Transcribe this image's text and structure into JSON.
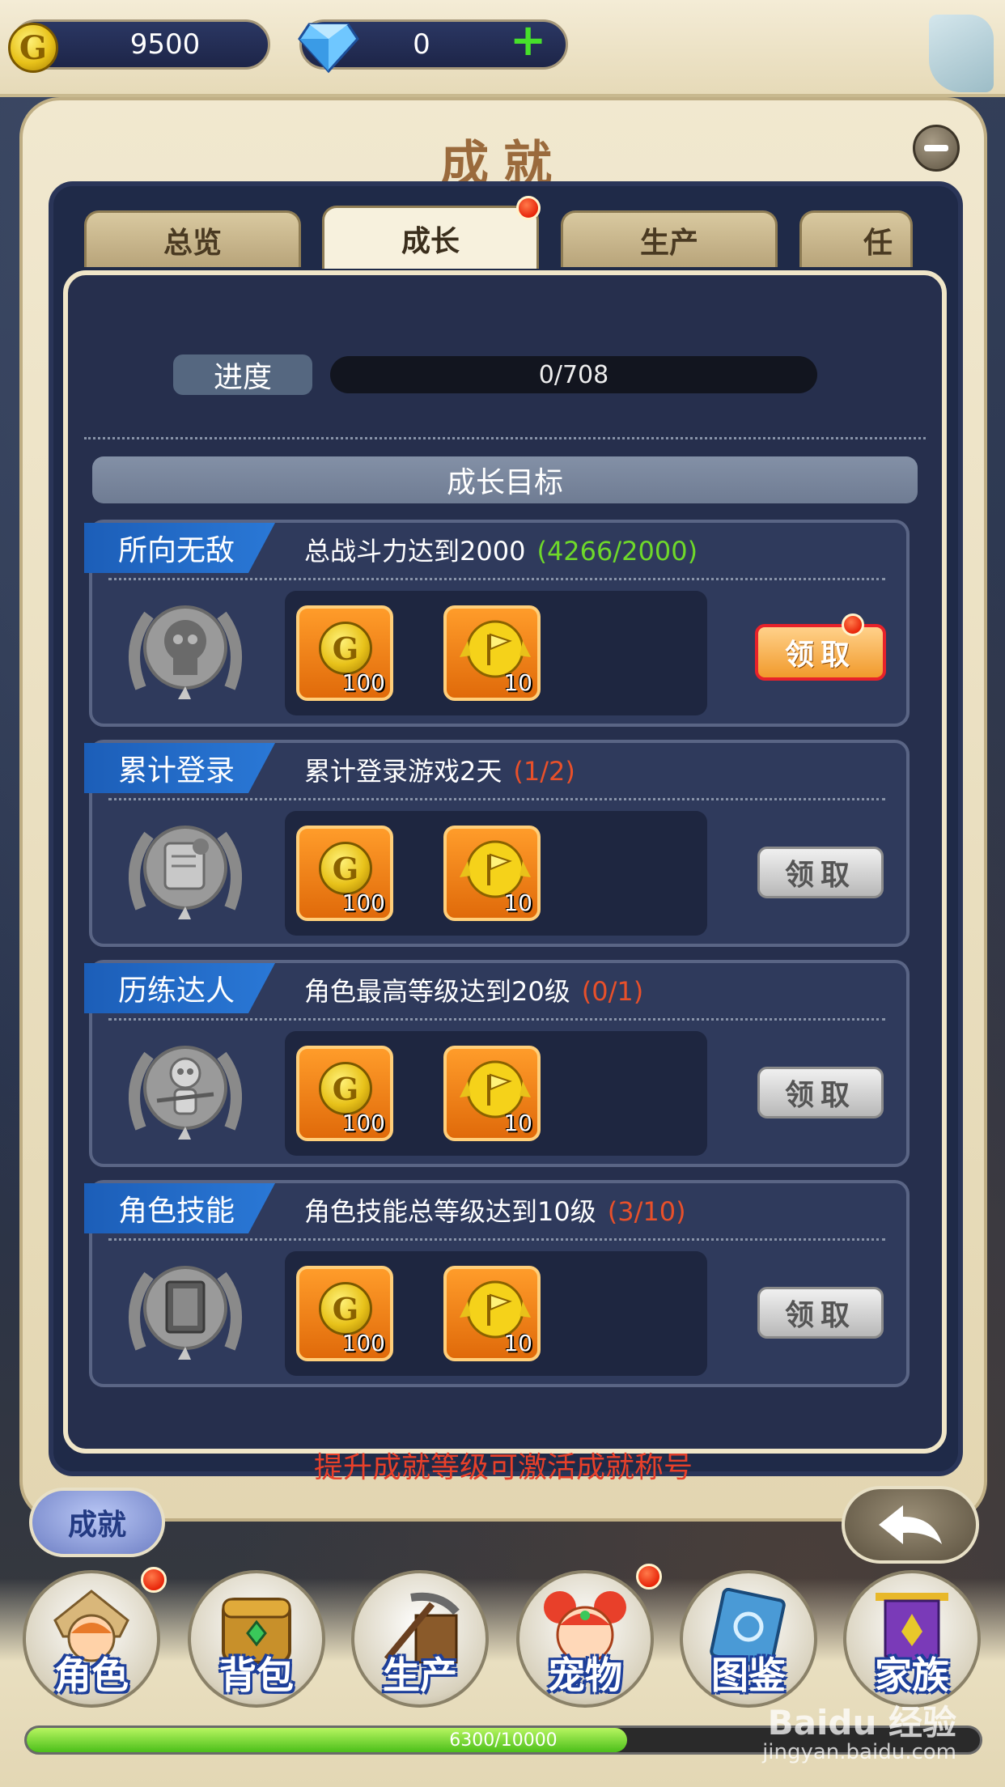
{
  "resources": {
    "gold_symbol": "G",
    "gold": "9500",
    "gems": "0",
    "add_symbol": "+"
  },
  "panel": {
    "title": "成就"
  },
  "tabs": [
    {
      "label": "总览",
      "active": false,
      "badge": false
    },
    {
      "label": "成长",
      "active": true,
      "badge": true
    },
    {
      "label": "生产",
      "active": false,
      "badge": false
    },
    {
      "label": "任",
      "active": false,
      "badge": false
    }
  ],
  "progress": {
    "label": "进度",
    "value": "0/708"
  },
  "section_title": "成长目标",
  "achievements": [
    {
      "name": "所向无敌",
      "desc": "总战斗力达到2000",
      "progress": "(4266/2000)",
      "progress_color": "green",
      "medal_icon": "skull-medal-icon",
      "rewards": [
        {
          "icon": "gold-coin-icon",
          "symbol": "G",
          "count": "100"
        },
        {
          "icon": "flag-coin-icon",
          "count": "10"
        }
      ],
      "claim_label": "领取",
      "claimable": true
    },
    {
      "name": "累计登录",
      "desc": "累计登录游戏2天",
      "progress": "(1/2)",
      "progress_color": "red",
      "medal_icon": "scroll-medal-icon",
      "rewards": [
        {
          "icon": "gold-coin-icon",
          "symbol": "G",
          "count": "100"
        },
        {
          "icon": "flag-coin-icon",
          "count": "10"
        }
      ],
      "claim_label": "领取",
      "claimable": false
    },
    {
      "name": "历练达人",
      "desc": "角色最高等级达到20级",
      "progress": "(0/1)",
      "progress_color": "red",
      "medal_icon": "skeleton-medal-icon",
      "rewards": [
        {
          "icon": "gold-coin-icon",
          "symbol": "G",
          "count": "100"
        },
        {
          "icon": "flag-coin-icon",
          "count": "10"
        }
      ],
      "claim_label": "领取",
      "claimable": false
    },
    {
      "name": "角色技能",
      "desc": "角色技能总等级达到10级",
      "progress": "(3/10)",
      "progress_color": "red",
      "medal_icon": "book-medal-icon",
      "rewards": [
        {
          "icon": "gold-coin-icon",
          "symbol": "G",
          "count": "100"
        },
        {
          "icon": "flag-coin-icon",
          "count": "10"
        }
      ],
      "claim_label": "领取",
      "claimable": false
    }
  ],
  "hint": "提升成就等级可激活成就称号",
  "achievement_button": "成就",
  "nav": [
    {
      "label": "角色",
      "icon": "character-icon",
      "badge": true
    },
    {
      "label": "背包",
      "icon": "backpack-icon",
      "badge": false
    },
    {
      "label": "生产",
      "icon": "pickaxe-icon",
      "badge": false
    },
    {
      "label": "宠物",
      "icon": "pet-icon",
      "badge": true
    },
    {
      "label": "图鉴",
      "icon": "codex-icon",
      "badge": false
    },
    {
      "label": "家族",
      "icon": "guild-banner-icon",
      "badge": false
    }
  ],
  "experience": {
    "text": "6300/10000",
    "fraction": 0.63
  },
  "watermark": {
    "brand": "Baidu 经验",
    "url": "jingyan.baidu.com"
  }
}
